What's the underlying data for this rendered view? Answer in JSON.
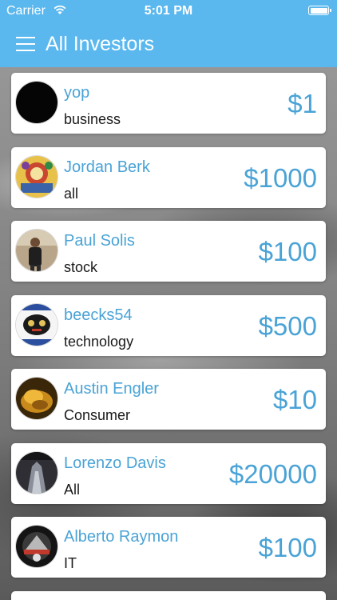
{
  "status_bar": {
    "carrier": "Carrier",
    "time": "5:01 PM",
    "wifi_icon": "wifi-icon",
    "battery_icon": "battery-icon"
  },
  "header": {
    "title": "All Investors",
    "menu_icon": "hamburger-menu-icon",
    "color": "#5ab8ef"
  },
  "accent_color": "#4aa3d6",
  "investors": [
    {
      "name": "yop",
      "category": "business",
      "amount": "$1"
    },
    {
      "name": "Jordan Berk",
      "category": "all",
      "amount": "$1000"
    },
    {
      "name": "Paul Solis",
      "category": "stock",
      "amount": "$100"
    },
    {
      "name": "beecks54",
      "category": "technology",
      "amount": "$500"
    },
    {
      "name": "Austin Engler",
      "category": "Consumer",
      "amount": "$10"
    },
    {
      "name": "Lorenzo Davis",
      "category": "All",
      "amount": "$20000"
    },
    {
      "name": "Alberto Raymon",
      "category": "IT",
      "amount": "$100"
    }
  ]
}
